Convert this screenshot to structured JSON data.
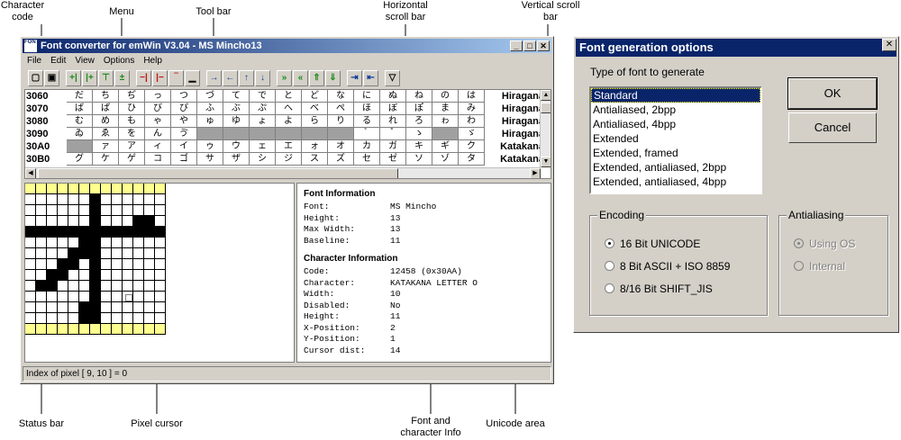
{
  "callouts": {
    "character_code": "Character\ncode",
    "menu": "Menu",
    "tool_bar": "Tool bar",
    "horizontal_scroll_bar": "Horizontal\nscroll bar",
    "vertical_scroll_bar": "Vertical scroll\nbar",
    "status_bar": "Status bar",
    "pixel_cursor": "Pixel cursor",
    "font_info": "Font and\ncharacter Info",
    "unicode_area": "Unicode area"
  },
  "window": {
    "title": "Font converter for emWin V3.04 - MS Mincho13",
    "icon_text": "FONT",
    "menu": [
      "File",
      "Edit",
      "View",
      "Options",
      "Help"
    ]
  },
  "toolbar_icons": [
    "new-icon",
    "save-icon",
    "insert-col-left-icon",
    "insert-col-right-icon",
    "insert-row-top-icon",
    "insert-row-bottom-icon",
    "delete-col-left-icon",
    "delete-col-right-icon",
    "delete-row-top-icon",
    "delete-row-bottom-icon",
    "move-right-icon",
    "move-left-icon",
    "move-up-icon",
    "move-down-icon",
    "grow-right-icon",
    "grow-left-icon",
    "grow-up-icon",
    "grow-down-icon",
    "shrink-right-icon",
    "shrink-left-icon",
    "filter-icon"
  ],
  "char_table": [
    {
      "code": "3060",
      "area": "Hiragana",
      "chars": [
        "だ",
        "ち",
        "ぢ",
        "っ",
        "つ",
        "づ",
        "て",
        "で",
        "と",
        "ど",
        "な",
        "に",
        "ぬ",
        "ね",
        "の",
        "は"
      ]
    },
    {
      "code": "3070",
      "area": "Hiragana",
      "chars": [
        "ば",
        "ぱ",
        "ひ",
        "び",
        "ぴ",
        "ふ",
        "ぶ",
        "ぷ",
        "へ",
        "べ",
        "ぺ",
        "ほ",
        "ぼ",
        "ぽ",
        "ま",
        "み"
      ]
    },
    {
      "code": "3080",
      "area": "Hiragana",
      "chars": [
        "む",
        "め",
        "も",
        "ゃ",
        "や",
        "ゅ",
        "ゆ",
        "ょ",
        "よ",
        "ら",
        "り",
        "る",
        "れ",
        "ろ",
        "ゎ",
        "わ"
      ]
    },
    {
      "code": "3090",
      "area": "Hiragana",
      "chars": [
        "ゐ",
        "ゑ",
        "を",
        "ん",
        "ゔ",
        "",
        "",
        "",
        "",
        "",
        "",
        "゙",
        "゚",
        "ゝ",
        "",
        "ゞ"
      ]
    },
    {
      "code": "30A0",
      "area": "Katakana",
      "chars": [
        "",
        "ァ",
        "ア",
        "ィ",
        "イ",
        "ゥ",
        "ウ",
        "ェ",
        "エ",
        "ォ",
        "オ",
        "カ",
        "ガ",
        "キ",
        "ギ",
        "ク"
      ]
    },
    {
      "code": "30B0",
      "area": "Katakana",
      "chars": [
        "グ",
        "ケ",
        "ゲ",
        "コ",
        "ゴ",
        "サ",
        "ザ",
        "シ",
        "ジ",
        "ス",
        "ズ",
        "セ",
        "ゼ",
        "ソ",
        "ゾ",
        "タ"
      ]
    }
  ],
  "glyph": {
    "rows": [
      "yyyyyyyyyyyyy",
      "wwwwwwbwwwwww",
      "wwwwwwbwwwwww",
      "wwwwwwbwwwbbw",
      "bbbbbbbbbbbbb",
      "wwwwwbbwwwwww",
      "wwwwbbbwwwwww",
      "wwwbbwbwwwwww",
      "wwbbwwbwwwwww",
      "wbbwwwbwwwwww",
      "wwwwwwbwwwwww",
      "wwwwwbbwwwwww",
      "wwwwwbbwwwwww",
      "yyyyyyyyyyyyy"
    ],
    "cursor": {
      "x": 9,
      "y": 10
    }
  },
  "font_info": {
    "heading": "Font Information",
    "rows": [
      {
        "label": "Font:",
        "value": "MS Mincho"
      },
      {
        "label": "Height:",
        "value": "13"
      },
      {
        "label": "Max Width:",
        "value": "13"
      },
      {
        "label": "Baseline:",
        "value": "11"
      }
    ]
  },
  "char_info": {
    "heading": "Character Information",
    "rows": [
      {
        "label": "Code:",
        "value": "12458 (0x30AA)"
      },
      {
        "label": "Character:",
        "value": "KATAKANA LETTER O"
      },
      {
        "label": "Width:",
        "value": "10"
      },
      {
        "label": "Disabled:",
        "value": "No"
      },
      {
        "label": "Height:",
        "value": "11"
      },
      {
        "label": "X-Position:",
        "value": "2"
      },
      {
        "label": "Y-Position:",
        "value": "1"
      },
      {
        "label": "Cursor dist:",
        "value": "14"
      }
    ]
  },
  "status": "Index of pixel [ 9, 10 ] = 0",
  "dialog": {
    "title": "Font generation options",
    "type_label": "Type of font to generate",
    "font_types": [
      "Standard",
      "Antialiased, 2bpp",
      "Antialiased, 4bpp",
      "Extended",
      "Extended, framed",
      "Extended, antialiased, 2bpp",
      "Extended, antialiased, 4bpp"
    ],
    "selected_type": "Standard",
    "ok": "OK",
    "cancel": "Cancel",
    "encoding": {
      "title": "Encoding",
      "options": [
        "16 Bit UNICODE",
        "8 Bit ASCII + ISO 8859",
        "8/16 Bit SHIFT_JIS"
      ],
      "selected": "16 Bit UNICODE"
    },
    "antialiasing": {
      "title": "Antialiasing",
      "options": [
        "Using OS",
        "Internal"
      ],
      "selected": "Using OS",
      "disabled": true
    }
  }
}
